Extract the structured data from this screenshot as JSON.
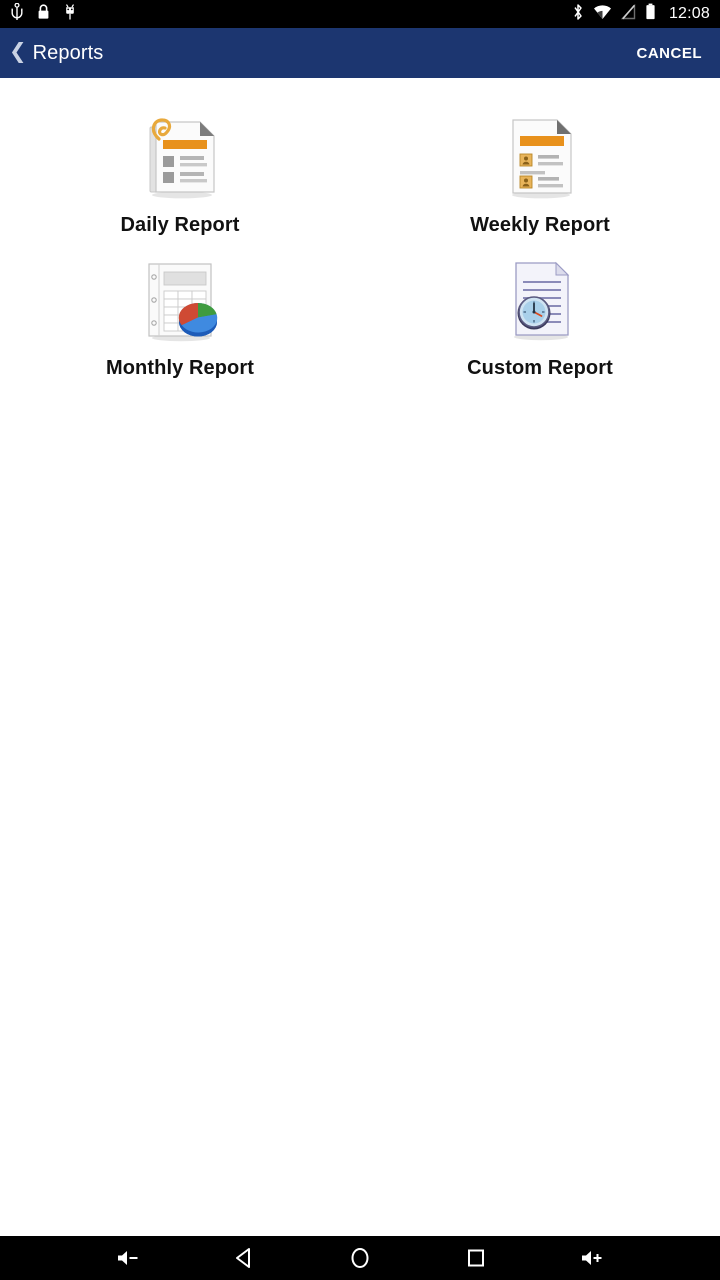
{
  "status_bar": {
    "left_icons": [
      "usb-icon",
      "lock-icon",
      "adb-android-icon"
    ],
    "right_icons": [
      "bluetooth-icon",
      "wifi-icon",
      "no-sim-signal-icon",
      "battery-icon"
    ],
    "time": "12:08",
    "background_color": "#000000",
    "foreground_color": "#ffffff"
  },
  "app_bar": {
    "back_chevron": "❮",
    "title": "Reports",
    "cancel_label": "CANCEL",
    "background_color": "#1c3670",
    "title_color": "#ffffff"
  },
  "content": {
    "background_color": "#ffffff",
    "reports": [
      {
        "label": "Daily Report",
        "icon": "document-paperclip-orange-icon"
      },
      {
        "label": "Weekly Report",
        "icon": "document-contacts-orange-icon"
      },
      {
        "label": "Monthly Report",
        "icon": "spreadsheet-piechart-icon"
      },
      {
        "label": "Custom Report",
        "icon": "document-clock-icon"
      }
    ]
  },
  "nav_bar": {
    "buttons": [
      {
        "name": "volume-down-icon",
        "label": "Volume Down"
      },
      {
        "name": "back-icon",
        "label": "Back"
      },
      {
        "name": "home-icon",
        "label": "Home"
      },
      {
        "name": "recents-icon",
        "label": "Recents"
      },
      {
        "name": "volume-up-icon",
        "label": "Volume Up"
      }
    ],
    "background_color": "#000000",
    "foreground_color": "#ffffff"
  },
  "colors": {
    "accent_orange": "#e8911c",
    "header_blue": "#1c3670",
    "pie_red": "#cf4a34",
    "pie_green": "#3f9b3f",
    "pie_blue": "#2f6fd0",
    "paper_gray": "#f2f2f2",
    "paper_lavender": "#ececf6"
  }
}
